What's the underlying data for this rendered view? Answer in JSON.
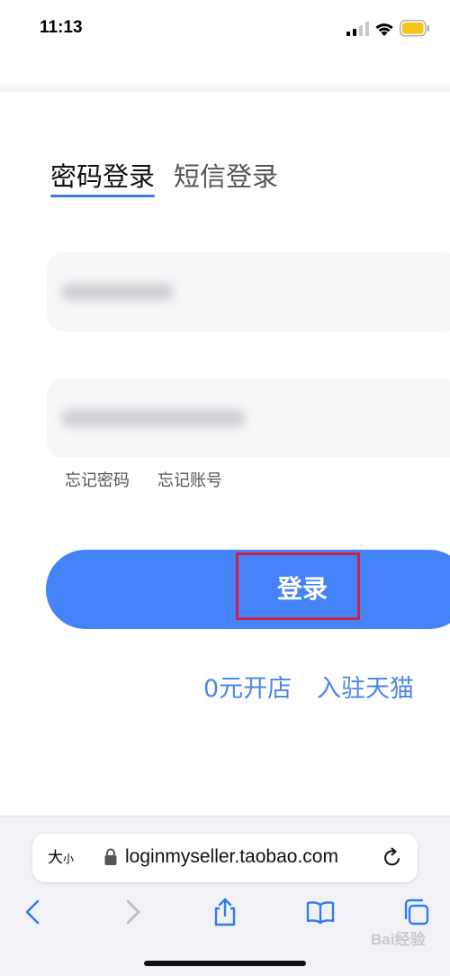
{
  "status_bar": {
    "time": "11:13"
  },
  "tabs": [
    {
      "label": "密码登录",
      "active": true
    },
    {
      "label": "短信登录",
      "active": false
    }
  ],
  "links": {
    "forgot_password": "忘记密码",
    "forgot_account": "忘记账号",
    "open_shop": "0元开店",
    "join_tmall": "入驻天猫"
  },
  "login_button": {
    "label": "登录"
  },
  "browser": {
    "text_size_big": "大",
    "text_size_small": "小",
    "url": "loginmyseller.taobao.com"
  },
  "colors": {
    "accent": "#4482f8",
    "link": "#4b86e8",
    "highlight": "#d0204a",
    "battery": "#f5c518"
  },
  "watermark": "Bai经验"
}
